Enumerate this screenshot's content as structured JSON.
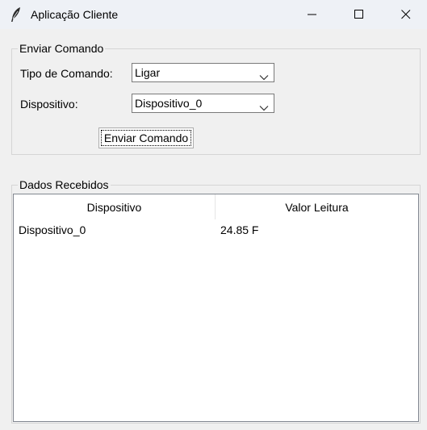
{
  "window": {
    "title": "Aplicação Cliente"
  },
  "send_group": {
    "title": "Enviar Comando",
    "command_type_label": "Tipo de Comando:",
    "command_type_value": "Ligar",
    "device_label": "Dispositivo:",
    "device_value": "Dispositivo_0",
    "send_button_label": "Enviar Comando"
  },
  "data_group": {
    "title": "Dados Recebidos",
    "columns": [
      "Dispositivo",
      "Valor Leitura"
    ],
    "rows": [
      [
        "Dispositivo_0",
        "24.85 F"
      ]
    ]
  },
  "icons": {
    "app": "feather-icon",
    "minimize": "minimize-icon",
    "maximize": "maximize-icon",
    "close": "close-icon",
    "dropdown": "chevron-down-icon"
  }
}
